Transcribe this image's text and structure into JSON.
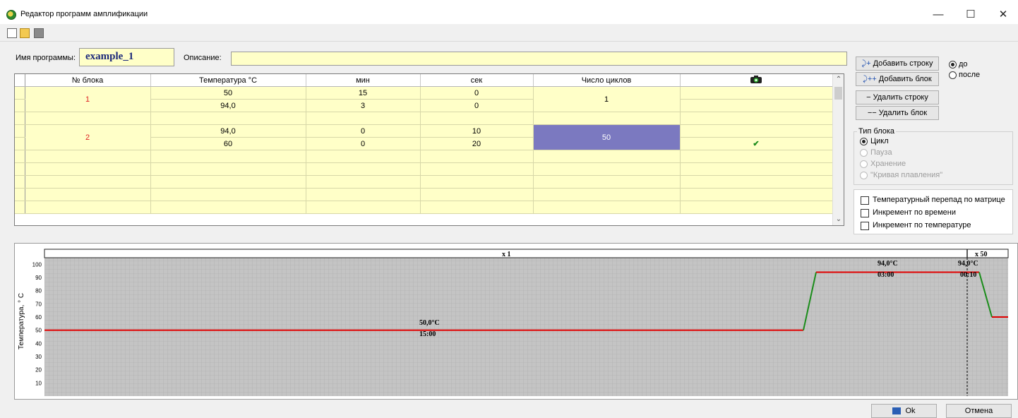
{
  "window": {
    "title": "Редактор программ амплификации",
    "minimize": "—",
    "maximize": "☐",
    "close": "✕"
  },
  "toolbar": [
    "new-icon",
    "open-folder-icon",
    "save-icon"
  ],
  "program": {
    "name_label": "Имя программы:",
    "name_value": "example_1",
    "desc_label": "Описание:",
    "desc_value": ""
  },
  "table": {
    "headers": [
      "№ блока",
      "Температура °C",
      "мин",
      "сек",
      "Число циклов",
      "camera-icon"
    ],
    "rows": [
      {
        "block": "1",
        "temp": "50",
        "min": "15",
        "sec": "0",
        "cycles": "1",
        "snap": ""
      },
      {
        "block": "",
        "temp": "94,0",
        "min": "3",
        "sec": "0",
        "cycles": "",
        "snap": ""
      },
      {
        "block": "",
        "temp": "",
        "min": "",
        "sec": "",
        "cycles": "",
        "snap": ""
      },
      {
        "block": "2",
        "temp": "94,0",
        "min": "0",
        "sec": "10",
        "cycles": "50",
        "snap": ""
      },
      {
        "block": "",
        "temp": "60",
        "min": "0",
        "sec": "20",
        "cycles": "",
        "snap": "✔"
      }
    ]
  },
  "right_panel": {
    "add_row": "Добавить строку",
    "add_block": "Добавить блок",
    "delete_row": "Удалить строку",
    "delete_block": "Удалить блок",
    "position_before": "до",
    "position_after": "после",
    "position_selected": "до",
    "block_type_title": "Тип блока",
    "block_types": [
      "Цикл",
      "Пауза",
      "Хранение",
      "\"Кривая плавления\""
    ],
    "block_type_selected": "Цикл",
    "checkboxes": [
      "Температурный перепад по матрице",
      "Инкремент по времени",
      "Инкремент по температуре"
    ],
    "checkbox_state": [
      false,
      false,
      false
    ]
  },
  "chart": {
    "ylabel": "Температура, ° С",
    "yticks": [
      "100",
      "90",
      "80",
      "70",
      "60",
      "50",
      "40",
      "30",
      "20",
      "10"
    ],
    "block_labels": [
      "x 1",
      "x 50"
    ],
    "step_labels": [
      {
        "temp": "50,0°C",
        "time": "15:00"
      },
      {
        "temp": "94,0°C",
        "time": "03:00"
      },
      {
        "temp": "94,0°C",
        "time": "00:10"
      }
    ]
  },
  "chart_data": {
    "type": "line",
    "ylabel": "Температура, ° С",
    "ylim": [
      0,
      105
    ],
    "grid": true,
    "steps": [
      {
        "block": 1,
        "temp": 50,
        "time": "15:00"
      },
      {
        "block": 1,
        "temp": 94,
        "time": "03:00"
      },
      {
        "block": 2,
        "temp": 94,
        "time": "00:10"
      },
      {
        "block": 2,
        "temp": 60,
        "time": "00:20"
      }
    ],
    "plateau_color": "#e00000",
    "ramp_color": "#1a8c1a"
  },
  "buttons": {
    "ok": "Ok",
    "cancel": "Отмена"
  }
}
